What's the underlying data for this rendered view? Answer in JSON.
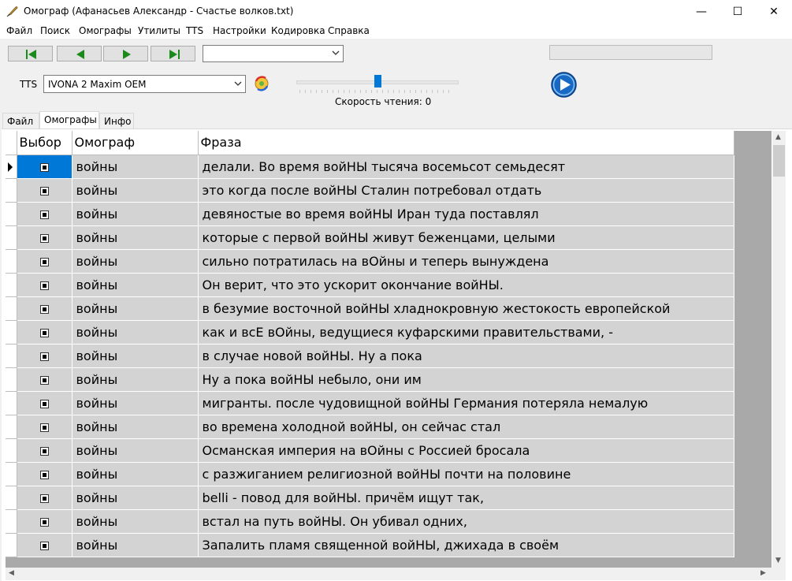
{
  "window": {
    "title": "Омограф (Афанасьев Александр - Счастье волков.txt)",
    "controls": [
      "—",
      "☐",
      "✕"
    ]
  },
  "menu": [
    "Файл",
    "Поиск",
    "Омографы",
    "Утилиты",
    "TTS",
    "Настройки",
    "Кодировка",
    "Справка"
  ],
  "toolbar": {
    "combo_value": "",
    "tts_label": "TTS",
    "voice": "IVONA 2 Maxim OEM",
    "speed_label": "Скорость чтения: 0",
    "speed_value": 0,
    "progress": 0
  },
  "tabs": [
    "Файл",
    "Омографы",
    "Инфо"
  ],
  "active_tab": 1,
  "grid": {
    "columns": [
      "Выбор",
      "Омограф",
      "Фраза"
    ],
    "rows": [
      {
        "selected": true,
        "homograph": "войны",
        "phrase": "делали. Во время войНЫ тысяча восемьсот семьдесят"
      },
      {
        "selected": true,
        "homograph": "войны",
        "phrase": "это когда после войНЫ Сталин потребовал отдать"
      },
      {
        "selected": true,
        "homograph": "войны",
        "phrase": "девяностые во время войНЫ Иран туда поставлял"
      },
      {
        "selected": true,
        "homograph": "войны",
        "phrase": "которые с первой войНЫ живут беженцами, целыми"
      },
      {
        "selected": true,
        "homograph": "войны",
        "phrase": "сильно потратилась на вОйны и теперь вынуждена"
      },
      {
        "selected": true,
        "homograph": "войны",
        "phrase": "Он верит, что это ускорит окончание войНЫ."
      },
      {
        "selected": true,
        "homograph": "войны",
        "phrase": "в безумие восточной войНЫ хладнокровную жестокость европейской"
      },
      {
        "selected": true,
        "homograph": "войны",
        "phrase": "как и всЕ вОйны, ведущиеся куфарскими правительствами, -"
      },
      {
        "selected": true,
        "homograph": "войны",
        "phrase": "в случае новой войНЫ. Ну а пока"
      },
      {
        "selected": true,
        "homograph": "войны",
        "phrase": "Ну а пока войНЫ небыло, они им"
      },
      {
        "selected": true,
        "homograph": "войны",
        "phrase": "мигранты. после чудовищной войНЫ Германия потеряла немалую"
      },
      {
        "selected": true,
        "homograph": "войны",
        "phrase": "во времена холодной войНЫ, он сейчас стал"
      },
      {
        "selected": true,
        "homograph": "войны",
        "phrase": "Османская империя на вОйны с Россией бросала"
      },
      {
        "selected": true,
        "homograph": "войны",
        "phrase": "с разжиганием религиозной войНЫ почти на половине"
      },
      {
        "selected": true,
        "homograph": "войны",
        "phrase": "belli - повод для войНЫ. причём ищут так,"
      },
      {
        "selected": true,
        "homograph": "войны",
        "phrase": "встал на путь войНЫ. Он убивал одних,"
      },
      {
        "selected": true,
        "homograph": "войны",
        "phrase": "Запалить пламя священной войНЫ, джихада в своём"
      }
    ]
  },
  "colors": {
    "accent": "#0078d7",
    "cell_bg": "#d3d3d3",
    "grid_bg": "#a9a9a9"
  }
}
